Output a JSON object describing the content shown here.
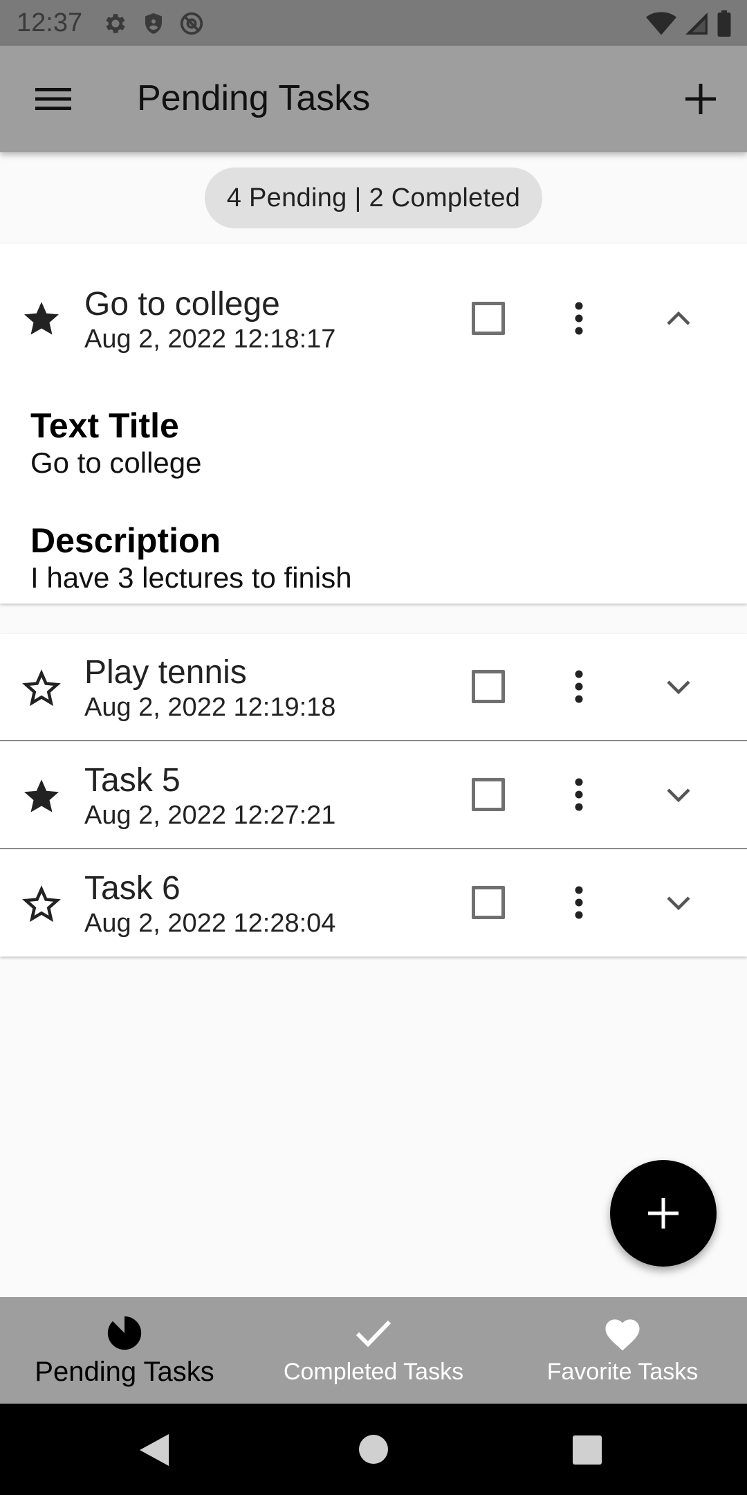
{
  "status_bar": {
    "time": "12:37",
    "icons_left": [
      "gear-icon",
      "shield-icon",
      "at-sign-icon"
    ],
    "icons_right": [
      "wifi-icon",
      "signal-icon",
      "battery-icon"
    ]
  },
  "app_bar": {
    "title": "Pending Tasks",
    "menu_icon": "hamburger-menu-icon",
    "add_icon": "plus-icon"
  },
  "summary": "4 Pending | 2 Completed",
  "tasks": [
    {
      "title": "Go to college",
      "date": "Aug 2, 2022 12:18:17",
      "favorite": true,
      "checked": false,
      "expanded": true,
      "details": {
        "title_label": "Text Title",
        "title_value": "Go to college",
        "description_label": "Description",
        "description_value": "I have 3 lectures to finish"
      }
    },
    {
      "title": "Play tennis",
      "date": "Aug 2, 2022 12:19:18",
      "favorite": false,
      "checked": false,
      "expanded": false
    },
    {
      "title": "Task 5",
      "date": "Aug 2, 2022 12:27:21",
      "favorite": true,
      "checked": false,
      "expanded": false
    },
    {
      "title": "Task 6",
      "date": "Aug 2, 2022 12:28:04",
      "favorite": false,
      "checked": false,
      "expanded": false
    }
  ],
  "fab_icon": "plus-icon",
  "bottom_nav": {
    "items": [
      {
        "label": "Pending Tasks",
        "icon": "pie-chart-icon",
        "active": true
      },
      {
        "label": "Completed Tasks",
        "icon": "checkmark-icon",
        "active": false
      },
      {
        "label": "Favorite Tasks",
        "icon": "heart-icon",
        "active": false
      }
    ]
  },
  "system_nav": [
    "back-icon",
    "home-icon",
    "recents-icon"
  ],
  "colors": {
    "app_bar": "#9e9e9e",
    "status_bar": "#7a7a7a",
    "background": "#fafafa",
    "chip": "#e0e0e0",
    "fab": "#000000"
  }
}
